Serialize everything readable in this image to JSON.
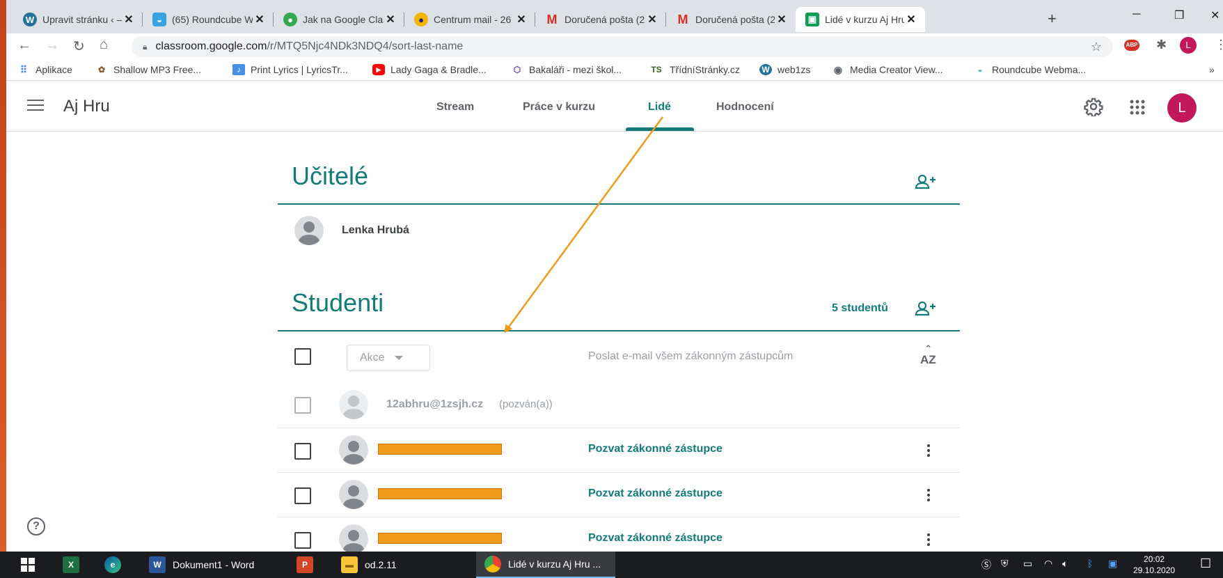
{
  "browser": {
    "tabs": [
      {
        "title": "Upravit stránku ‹ –",
        "icon": "wordpress-icon"
      },
      {
        "title": "(65) Roundcube W",
        "icon": "roundcube-icon"
      },
      {
        "title": "Jak na Google Clas",
        "icon": "google-classroom-icon"
      },
      {
        "title": "Centrum mail - 26",
        "icon": "centrum-icon"
      },
      {
        "title": "Doručená pošta (2",
        "icon": "gmail-icon"
      },
      {
        "title": "Doručená pošta (2",
        "icon": "gmail-icon"
      },
      {
        "title": "Lidé v kurzu Aj Hru",
        "icon": "classroom-icon"
      }
    ],
    "new_tab": "+",
    "window_controls": {
      "minimize": "─",
      "restore": "❐",
      "close": "✕"
    },
    "url_host": "classroom.google.com",
    "url_path": "/r/MTQ5Njc4NDk3NDQ4/sort-last-name",
    "profile_initial": "L",
    "extension_abp": "ABP",
    "bookmarks": [
      {
        "label": "Aplikace",
        "icon": "apps-grid-icon"
      },
      {
        "label": "Shallow MP3 Free...",
        "icon": "paw-icon"
      },
      {
        "label": "Print Lyrics | LyricsTr...",
        "icon": "lyrics-icon"
      },
      {
        "label": "Lady Gaga & Bradle...",
        "icon": "youtube-icon"
      },
      {
        "label": "Bakaláři - mezi škol...",
        "icon": "bakalari-icon"
      },
      {
        "label": "TřídníStránky.cz",
        "icon": "ts-icon",
        "icon_text": "TS"
      },
      {
        "label": "web1zs",
        "icon": "wordpress-icon"
      },
      {
        "label": "Media Creator View...",
        "icon": "globe-icon"
      },
      {
        "label": "Roundcube Webma...",
        "icon": "roundcube-icon"
      }
    ],
    "bookmarks_more": "»"
  },
  "classroom": {
    "class_name": "Aj Hru",
    "nav_tabs": [
      "Stream",
      "Práce v kurzu",
      "Lidé",
      "Hodnocení"
    ],
    "active_tab": "Lidé",
    "user_initial": "L",
    "teachers_title": "Učitelé",
    "teacher_name": "Lenka Hrubá",
    "students_title": "Studenti",
    "students_count": "5 studentů",
    "actions_label": "Akce",
    "email_guardians_all": "Poslat e-mail všem zákonným zástupcům",
    "sort_label": "AZ",
    "invited_email": "12abhru@1zsjh.cz",
    "invited_status": "(pozván(a))",
    "invite_guardians": "Pozvat zákonné zástupce",
    "students": [
      {
        "name": "",
        "redacted": true
      },
      {
        "name": "",
        "redacted": true
      },
      {
        "name": "",
        "redacted": true
      }
    ],
    "help": "?"
  },
  "taskbar": {
    "items": [
      {
        "label": "",
        "icon": "excel-icon",
        "icon_text": "X"
      },
      {
        "label": "",
        "icon": "edge-icon"
      },
      {
        "label": "Dokument1 - Word",
        "icon": "word-icon",
        "icon_text": "W"
      },
      {
        "label": "",
        "icon": "powerpoint-icon",
        "icon_text": "P"
      },
      {
        "label": "od.2.11",
        "icon": "folder-icon"
      },
      {
        "label": "Lidé v kurzu Aj Hru ...",
        "icon": "chrome-icon"
      }
    ],
    "time": "20:02",
    "date": "29.10.2020"
  },
  "colors": {
    "accent": "#137c7b",
    "annotation_arrow": "#f29a1a",
    "redaction": "#f29a1a",
    "avatar": "#c2185b"
  }
}
